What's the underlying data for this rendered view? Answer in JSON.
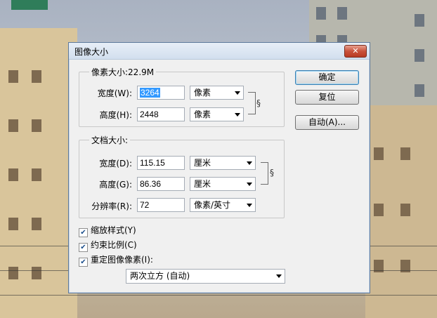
{
  "dialog": {
    "title": "图像大小",
    "close_icon": "close-icon"
  },
  "pixel_dimensions": {
    "legend": "像素大小:22.9M",
    "width_label": "宽度(W):",
    "width_value": "3264",
    "width_unit": "像素",
    "height_label": "高度(H):",
    "height_value": "2448",
    "height_unit": "像素"
  },
  "document_size": {
    "legend": "文档大小:",
    "width_label": "宽度(D):",
    "width_value": "115.15",
    "width_unit": "厘米",
    "height_label": "高度(G):",
    "height_value": "86.36",
    "height_unit": "厘米",
    "resolution_label": "分辨率(R):",
    "resolution_value": "72",
    "resolution_unit": "像素/英寸"
  },
  "buttons": {
    "ok": "确定",
    "reset": "复位",
    "auto": "自动(A)..."
  },
  "options": {
    "scale_styles": {
      "label": "缩放样式(Y)",
      "checked": true
    },
    "constrain": {
      "label": "约束比例(C)",
      "checked": true
    },
    "resample": {
      "label": "重定图像像素(I):",
      "checked": true
    },
    "resample_method": "两次立方 (自动)"
  },
  "icons": {
    "check_mark": "✔",
    "chain_link": "§"
  }
}
